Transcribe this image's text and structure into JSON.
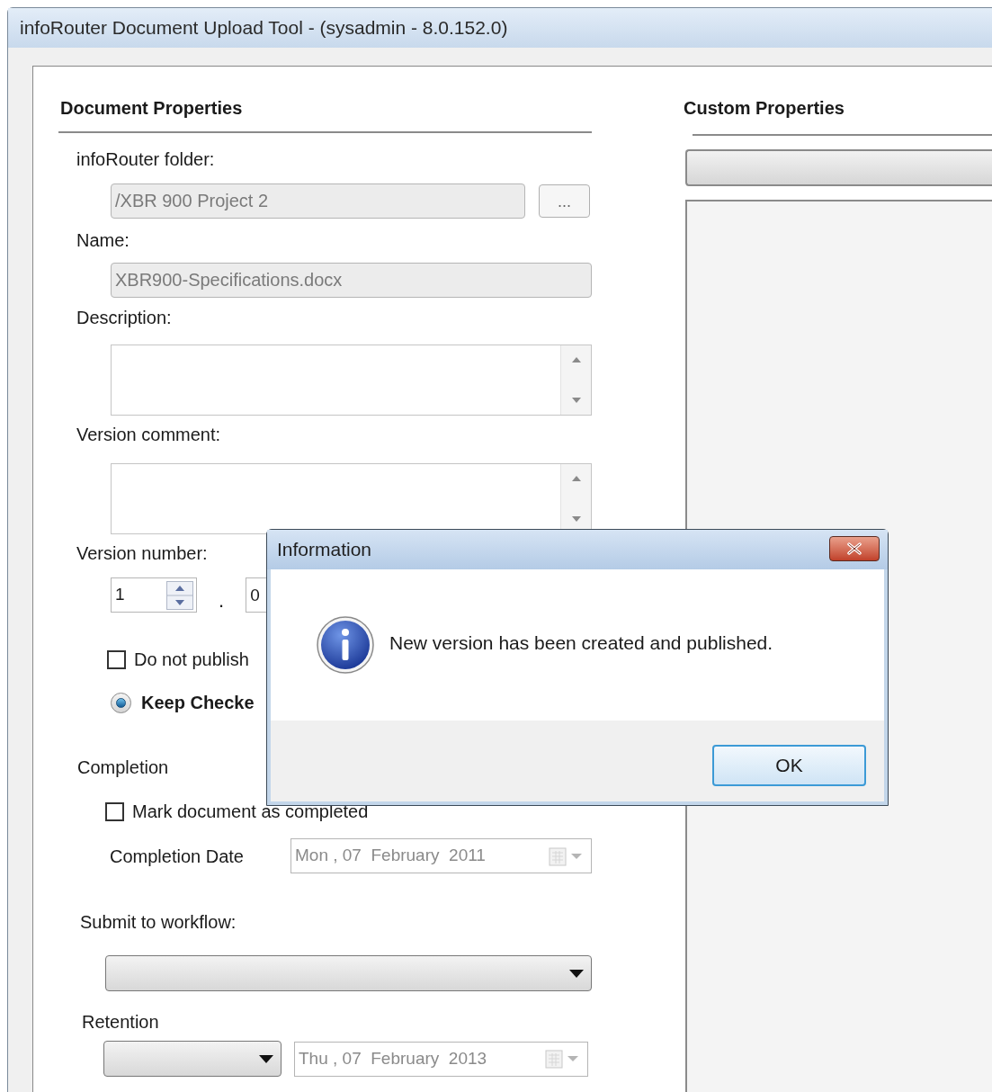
{
  "window": {
    "title": "infoRouter Document Upload Tool - (sysadmin - 8.0.152.0)"
  },
  "document_properties": {
    "heading": "Document Properties",
    "folder_label": "infoRouter folder:",
    "folder_value": "/XBR 900 Project 2",
    "browse_button": "...",
    "name_label": "Name:",
    "name_value": "XBR900-Specifications.docx",
    "description_label": "Description:",
    "version_comment_label": "Version comment:",
    "version_number_label": "Version number:",
    "version_major": "1",
    "version_separator": ".",
    "version_minor": "0",
    "do_not_publish": {
      "label": "Do not publish",
      "checked": false
    },
    "keep_checked_out": {
      "label": "Keep Checke",
      "selected": true
    },
    "completion_label": "Completion",
    "mark_completed": {
      "label": "Mark document as completed",
      "checked": false
    },
    "completion_date_label": "Completion Date",
    "completion_date_value": "Mon , 07  February  2011",
    "workflow_label": "Submit to workflow:",
    "retention_label": "Retention",
    "retention_date_value": "Thu , 07  February  2013"
  },
  "custom_properties": {
    "heading": "Custom Properties"
  },
  "dialog": {
    "title": "Information",
    "message": "New version has been created and published.",
    "ok_button": "OK"
  }
}
